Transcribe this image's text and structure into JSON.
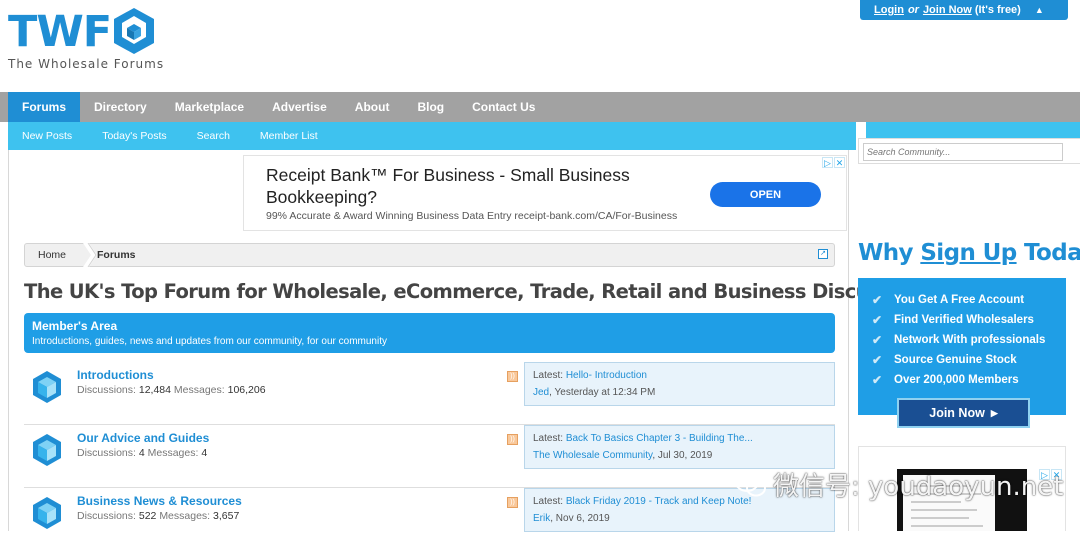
{
  "header": {
    "logo_letters": "TWF",
    "logo_tagline": "The Wholesale Forums",
    "login": {
      "login_label": "Login",
      "or_label": "or",
      "join_label": "Join Now",
      "suffix": "(It's free)",
      "caret": "▲"
    }
  },
  "nav": {
    "tabs": [
      {
        "label": "Forums",
        "active": true
      },
      {
        "label": "Directory"
      },
      {
        "label": "Marketplace"
      },
      {
        "label": "Advertise"
      },
      {
        "label": "About"
      },
      {
        "label": "Blog"
      },
      {
        "label": "Contact Us"
      }
    ],
    "sub_links": [
      "New Posts",
      "Today's Posts",
      "Search",
      "Member List"
    ]
  },
  "search": {
    "placeholder": "Search Community..."
  },
  "ad": {
    "headline": "Receipt Bank™ For Business - Small Business Bookkeeping?",
    "subtext": "99% Accurate & Award Winning Business Data Entry receipt-bank.com/CA/For-Business",
    "button": "OPEN"
  },
  "breadcrumb": [
    "Home",
    "Forums"
  ],
  "page_title": "The UK's Top Forum for Wholesale, eCommerce, Trade, Retail and Business Discussions",
  "member_area": {
    "title": "Member's Area",
    "description": "Introductions, guides, news and updates from our community, for our community"
  },
  "forums": [
    {
      "name": "Introductions",
      "discussions_label": "Discussions:",
      "discussions": "12,484",
      "messages_label": "Messages:",
      "messages": "106,206",
      "latest_label": "Latest:",
      "latest_title": "Hello- Introduction",
      "latest_user": "Jed",
      "latest_time": ", Yesterday at 12:34 PM"
    },
    {
      "name": "Our Advice and Guides",
      "discussions_label": "Discussions:",
      "discussions": "4",
      "messages_label": "Messages:",
      "messages": "4",
      "latest_label": "Latest:",
      "latest_title": "Back To Basics Chapter 3 - Building The...",
      "latest_user": "The Wholesale Community",
      "latest_time": ", Jul 30, 2019"
    },
    {
      "name": "Business News & Resources",
      "discussions_label": "Discussions:",
      "discussions": "522",
      "messages_label": "Messages:",
      "messages": "3,657",
      "latest_label": "Latest:",
      "latest_title": "Black Friday 2019 - Track and Keep Note!",
      "latest_user": "Erik",
      "latest_time": ", Nov 6, 2019"
    }
  ],
  "sidebar": {
    "why_prefix": "Why ",
    "why_link": "Sign Up",
    "why_suffix": " Today?",
    "benefits": [
      "You Get A Free Account",
      "Find Verified Wholesalers",
      "Network With professionals",
      "Source Genuine Stock",
      "Over 200,000 Members"
    ],
    "join_button": "Join Now"
  },
  "watermark": "微信号: youdaoyun.net",
  "colors": {
    "brand_blue": "#1f8ed4",
    "light_blue": "#3ec2ef",
    "nav_grey": "#a2a2a2"
  }
}
